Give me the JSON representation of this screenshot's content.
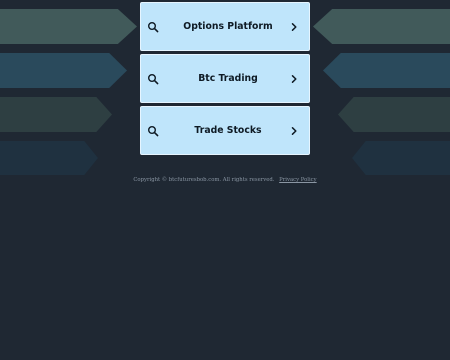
{
  "links": [
    {
      "label": "Options Platform",
      "icon": "search-icon",
      "arrow": "chevron-right-icon"
    },
    {
      "label": "Btc Trading",
      "icon": "search-icon",
      "arrow": "chevron-right-icon"
    },
    {
      "label": "Trade Stocks",
      "icon": "search-icon",
      "arrow": "chevron-right-icon"
    }
  ],
  "footer": {
    "copyright": "Copyright © btcfuturesbob.com.  All rights reserved.",
    "privacy_label": "Privacy Policy"
  },
  "colors": {
    "background": "#1f2833",
    "link_background": "#bfe5fb",
    "link_text": "#0e1a24",
    "footer_text": "#8a96a3",
    "decor_teal": "#415a5a",
    "decor_blue": "#2a4a5c"
  }
}
